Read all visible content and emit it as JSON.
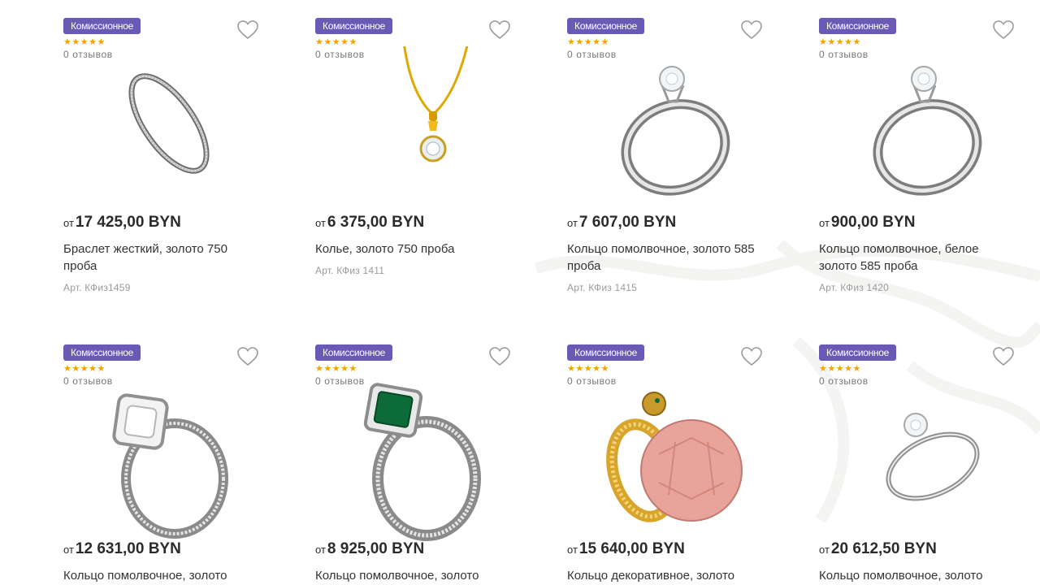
{
  "badge_label": "Комиссионное",
  "stars": "★★★★★",
  "price_prefix": "от",
  "colors": {
    "badge": "#6a5ab6",
    "stars": "#f4a400",
    "price": "#2b2b2b",
    "sku": "#9a9a9a",
    "heart_outline": "#9a9a9a"
  },
  "products": [
    {
      "reviews": "0 отзывов",
      "price": "17 425,00 BYN",
      "title": "Браслет жесткий, золото 750 проба",
      "sku": "Арт. КФиз1459",
      "image": "thin-bangle-bracelet"
    },
    {
      "reviews": "0 отзывов",
      "price": "6 375,00 BYN",
      "title": "Колье, золото 750 проба",
      "sku": "Арт. КФиз 1411",
      "image": "gold-chain-diamond-pendant"
    },
    {
      "reviews": "0 отзывов",
      "price": "7 607,00 BYN",
      "title": "Кольцо помолвочное, золото 585 проба",
      "sku": "Арт. КФиз 1415",
      "image": "solitaire-ring"
    },
    {
      "reviews": "0 отзывов",
      "price": "900,00 BYN",
      "title": "Кольцо помолвочное, белое золото 585 проба",
      "sku": "Арт. КФиз 1420",
      "image": "solitaire-ring"
    },
    {
      "reviews": "0 отзывов",
      "price": "12 631,00 BYN",
      "title": "Кольцо помолвочное, золото",
      "sku": "",
      "image": "halo-diamond-ring"
    },
    {
      "reviews": "0 отзывов",
      "price": "8 925,00 BYN",
      "title": "Кольцо помолвочное, золото",
      "sku": "",
      "image": "emerald-pave-ring"
    },
    {
      "reviews": "0 отзывов",
      "price": "15 640,00 BYN",
      "title": "Кольцо декоративное, золото",
      "sku": "",
      "image": "rose-quartz-turtle-ring"
    },
    {
      "reviews": "0 отзывов",
      "price": "20 612,50 BYN",
      "title": "Кольцо помолвочное, золото",
      "sku": "",
      "image": "thin-solitaire-ring"
    }
  ]
}
